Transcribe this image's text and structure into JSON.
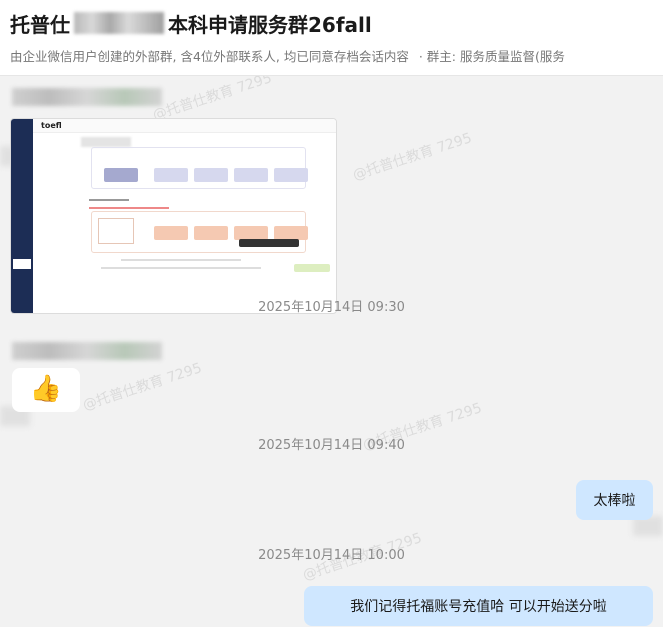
{
  "header": {
    "title_prefix": "托普仕",
    "title_suffix": "本科申请服务群26fall",
    "subtitle_info": "由企业微信用户创建的外部群, 含4位外部联系人, 均已同意存档会话内容",
    "subtitle_owner": "· 群主: 服务质量监督(服务"
  },
  "messages": {
    "ts1": "2025年10月14日 09:30",
    "ts2": "2025年10月14日 09:40",
    "ts3": "2025年10月14日 10:00",
    "msg_thumbs": "👍",
    "msg_reply1": "太棒啦",
    "msg_reply2": "我们记得托福账号充值哈 可以开始送分啦"
  },
  "screenshot_preview": {
    "logo": "toefl"
  },
  "watermark": {
    "text": "@托普仕教育 7295"
  },
  "colors": {
    "chat_bg": "#f2f2f2",
    "self_bubble": "#cfe7ff",
    "other_bubble": "#ffffff",
    "timestamp": "#8a8a8a"
  }
}
